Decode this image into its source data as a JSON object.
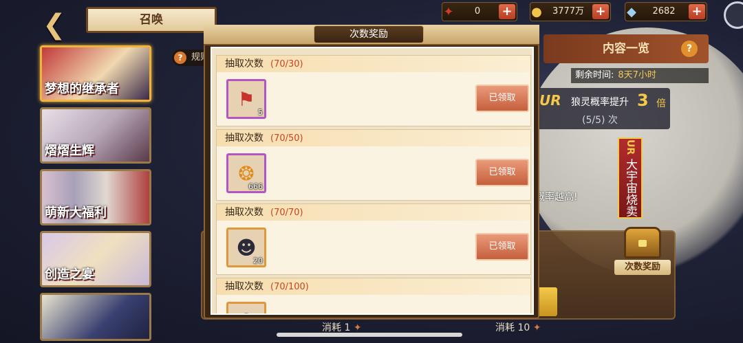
{
  "header": {
    "back_icon": "back-arrow-icon",
    "title": "召唤",
    "currencies": [
      {
        "icon": "red-token-icon",
        "value": "0"
      },
      {
        "icon": "gold-coin-icon",
        "value": "3777万"
      },
      {
        "icon": "crystal-icon",
        "value": "2682"
      }
    ]
  },
  "sidebar": {
    "rules_label": "规则",
    "banners": [
      {
        "name": "梦想的继承者",
        "active": true
      },
      {
        "name": "熠熠生辉",
        "active": false
      },
      {
        "name": "萌新大福利",
        "active": false
      },
      {
        "name": "创造之宴",
        "active": false
      },
      {
        "name": "",
        "active": false
      }
    ]
  },
  "right_panel": {
    "content_button": "内容一览",
    "time_label": "剩余时间:",
    "time_value": "8天7小时",
    "ur_tag": "UR",
    "ur_text": "狼灵概率提升",
    "ur_mult": "3",
    "ur_mult_unit": "倍",
    "ur_count": "(5/5) 次",
    "vertical_banner_tag": "UR",
    "vertical_banner": "大宇宙烧卖",
    "probability_text": "概率越高!",
    "chest_label": "次数奖励"
  },
  "bottom": {
    "cost1": "消耗 1",
    "cost10": "消耗 10"
  },
  "modal": {
    "title": "次数奖励",
    "rewards": [
      {
        "label": "抽取次数",
        "progress": "(70/30)",
        "icon": "totem-icon",
        "qty": "5",
        "frame": "purple",
        "button": "已领取"
      },
      {
        "label": "抽取次数",
        "progress": "(70/50)",
        "icon": "flame-orb-icon",
        "qty": "666",
        "frame": "purple",
        "button": "已领取"
      },
      {
        "label": "抽取次数",
        "progress": "(70/70)",
        "icon": "character-portrait-icon",
        "qty": "20",
        "frame": "orange",
        "button": "已领取"
      },
      {
        "label": "抽取次数",
        "progress": "(70/100)",
        "icon": "character-portrait-icon",
        "qty": "",
        "frame": "orange",
        "button": ""
      }
    ]
  }
}
